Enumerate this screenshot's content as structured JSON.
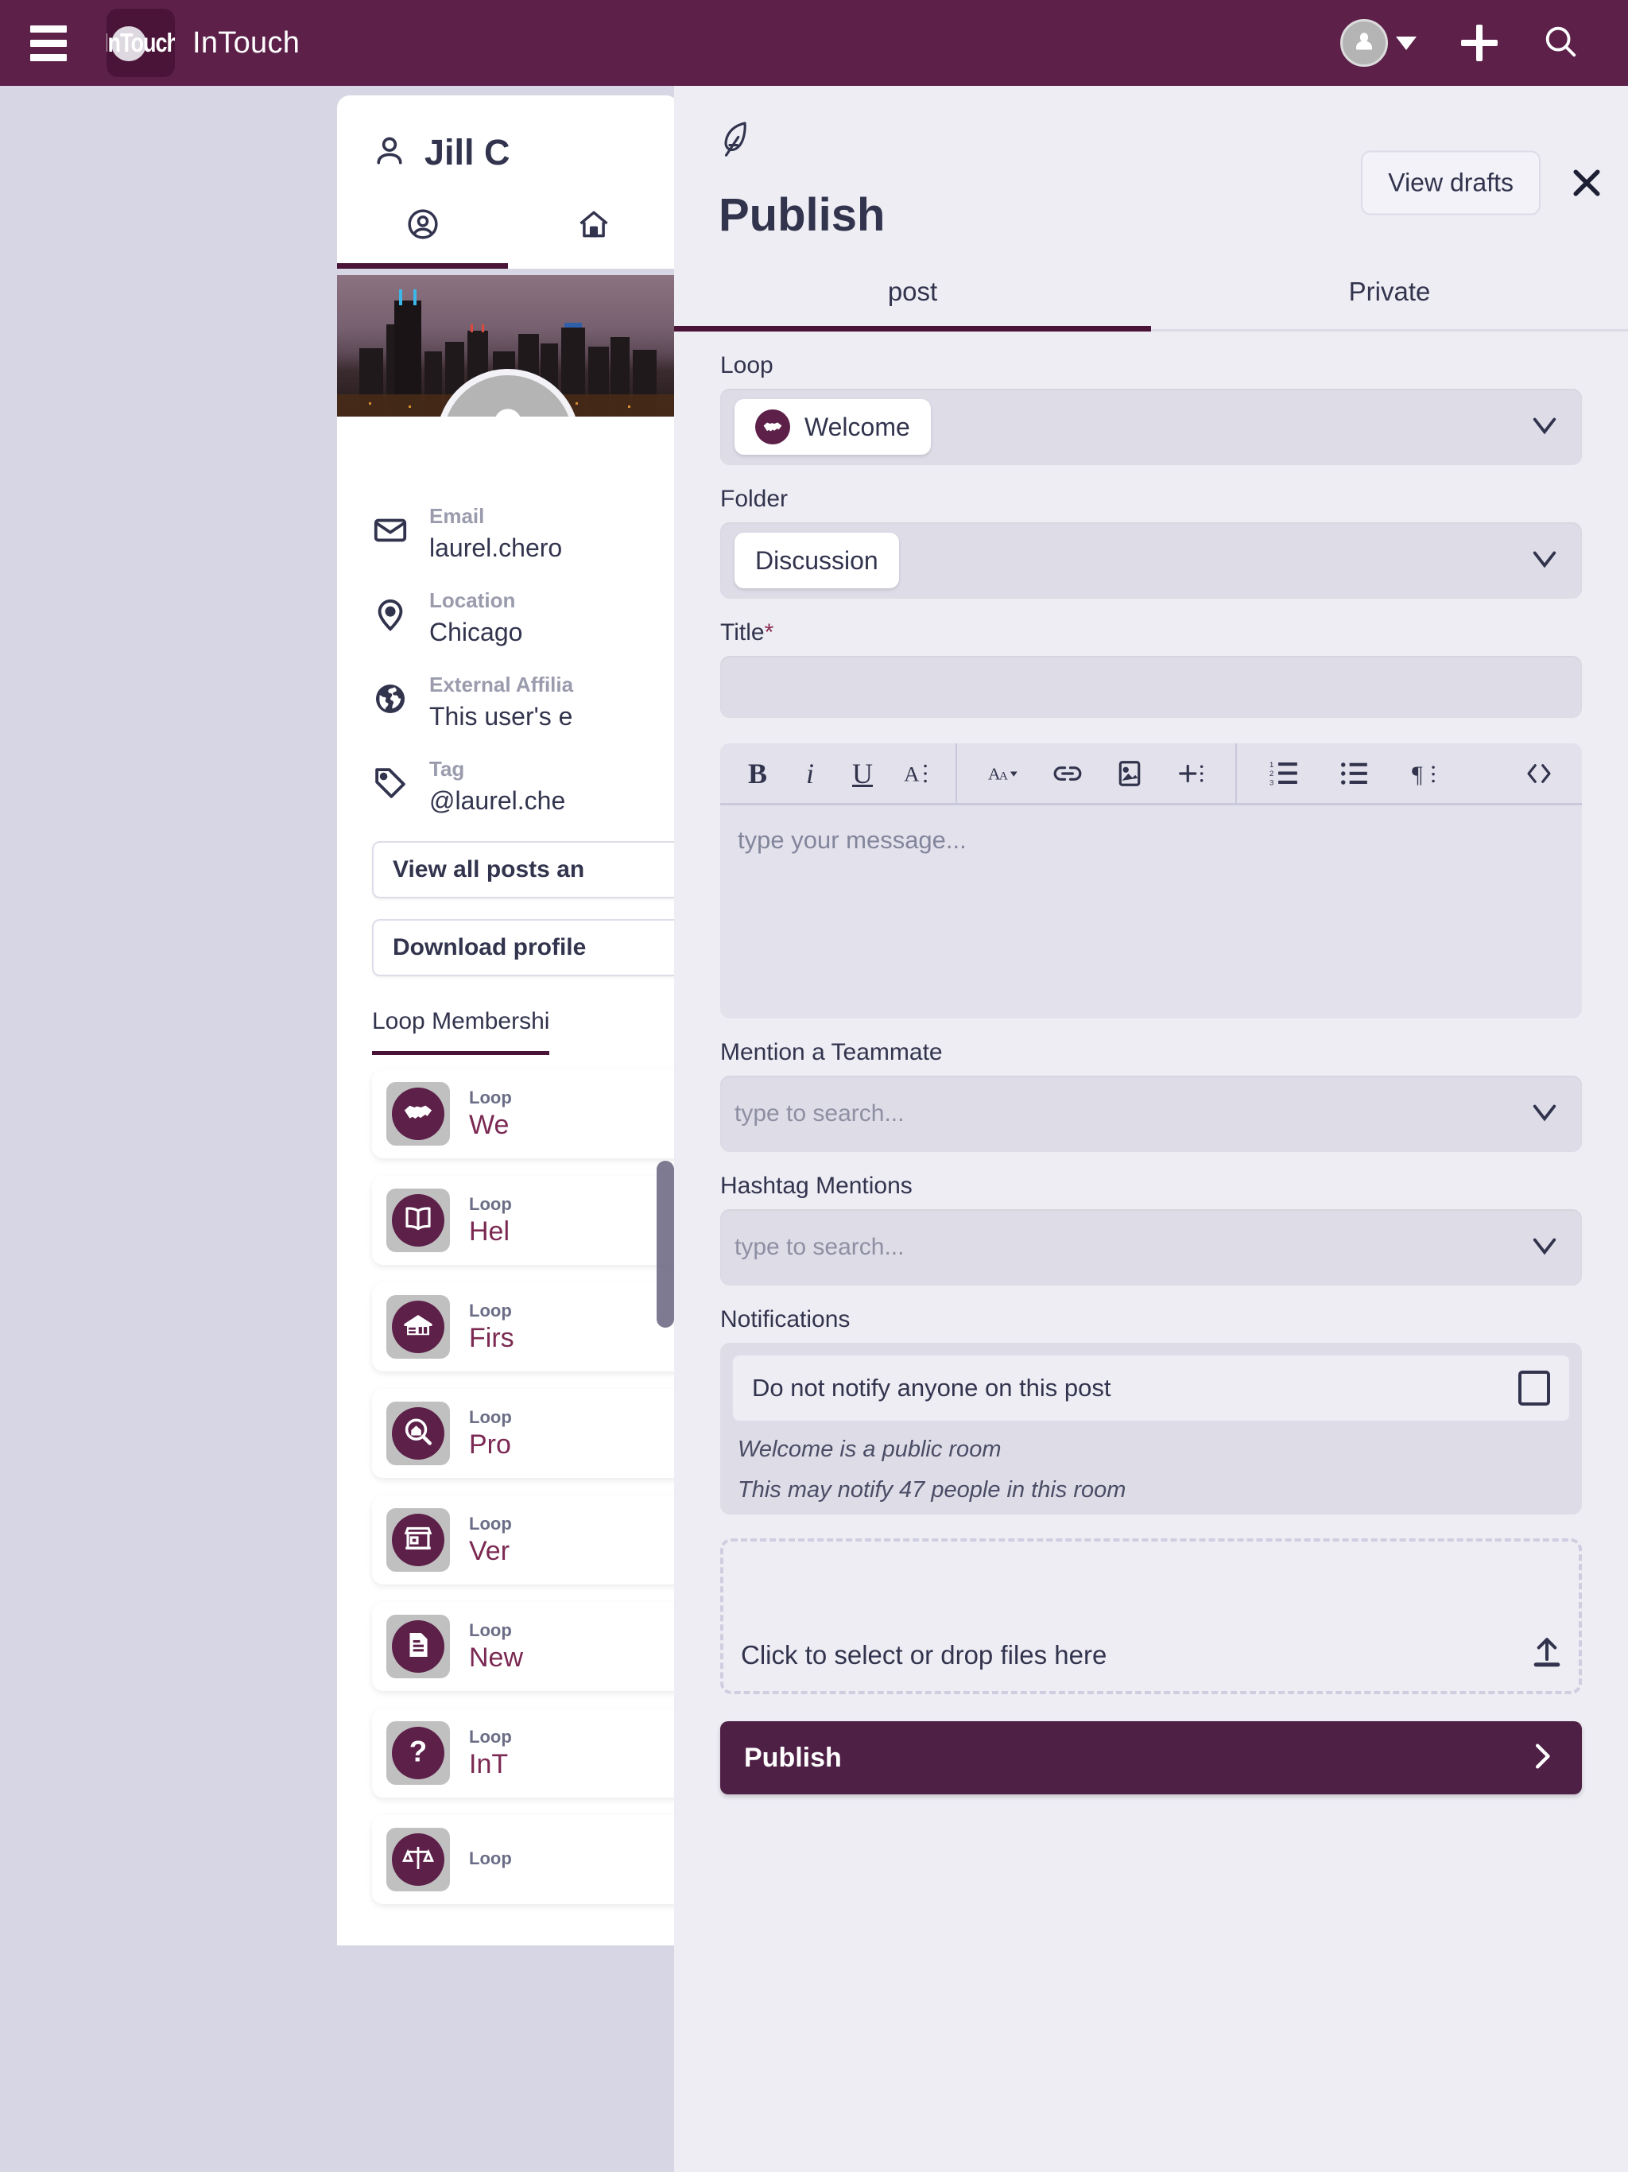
{
  "appbar": {
    "menu_icon": "hamburger-menu-icon",
    "logo_text": "InTouch",
    "brand": "InTouch",
    "avatar_icon": "user-avatar-icon",
    "caret_icon": "chevron-down-icon",
    "plus_icon": "plus-icon",
    "search_icon": "search-icon"
  },
  "profile": {
    "name": "Jill C",
    "name_icon": "person-icon",
    "tabs": [
      {
        "icon": "profile-circle-icon",
        "active": true
      },
      {
        "icon": "home-icon",
        "active": false
      }
    ],
    "avatar_icon": "user-avatar-icon",
    "fields": [
      {
        "icon": "envelope-icon",
        "label": "Email",
        "value": "laurel.chero"
      },
      {
        "icon": "location-pin-icon",
        "label": "Location",
        "value": "Chicago"
      },
      {
        "icon": "globe-icon",
        "label": "External Affilia",
        "value": "This user's e"
      },
      {
        "icon": "tag-icon",
        "label": "Tag",
        "value": "@laurel.che"
      }
    ],
    "buttons": [
      {
        "label": "View all posts an"
      },
      {
        "label": "Download profile"
      }
    ],
    "membership_tab": "Loop Membershi",
    "loops": [
      {
        "kicker": "Loop",
        "title": "We",
        "icon": "handshake-icon"
      },
      {
        "kicker": "Loop",
        "title": "Hel",
        "icon": "open-book-icon"
      },
      {
        "kicker": "Loop",
        "title": "Firs",
        "icon": "house-icon"
      },
      {
        "kicker": "Loop",
        "title": "Pro",
        "icon": "house-search-icon"
      },
      {
        "kicker": "Loop",
        "title": "Ver",
        "icon": "storefront-icon"
      },
      {
        "kicker": "Loop",
        "title": "New",
        "icon": "document-icon"
      },
      {
        "kicker": "Loop",
        "title": "InT",
        "icon": "question-mark-icon"
      },
      {
        "kicker": "Loop",
        "title": "",
        "icon": "scales-icon"
      }
    ]
  },
  "publish": {
    "feather_icon": "feather-pen-icon",
    "view_drafts_label": "View drafts",
    "close_icon": "close-icon",
    "title": "Publish",
    "tabs": [
      {
        "label": "post",
        "active": true
      },
      {
        "label": "Private",
        "active": false
      }
    ],
    "loop": {
      "label": "Loop",
      "selected": "Welcome",
      "chip_icon": "handshake-icon",
      "chevron_icon": "chevron-down-icon"
    },
    "folder": {
      "label": "Folder",
      "selected": "Discussion",
      "chevron_icon": "chevron-down-icon"
    },
    "title_field": {
      "label": "Title",
      "required_mark": "*",
      "value": "",
      "placeholder": ""
    },
    "toolbar": [
      {
        "name": "bold-icon",
        "glyph": "B"
      },
      {
        "name": "italic-icon",
        "glyph": "i"
      },
      {
        "name": "underline-icon",
        "glyph": "U"
      },
      {
        "name": "text-color-icon",
        "glyph": "A"
      },
      {
        "name": "font-size-icon",
        "glyph": "AA"
      },
      {
        "name": "link-icon",
        "glyph": "link"
      },
      {
        "name": "image-icon",
        "glyph": "image"
      },
      {
        "name": "insert-icon",
        "glyph": "plus"
      },
      {
        "name": "ordered-list-icon",
        "glyph": "ol"
      },
      {
        "name": "bullet-list-icon",
        "glyph": "ul"
      },
      {
        "name": "paragraph-icon",
        "glyph": "para"
      },
      {
        "name": "code-icon",
        "glyph": "code"
      },
      {
        "name": "emoji-icon",
        "glyph": "emoji"
      },
      {
        "name": "more-options-icon",
        "glyph": "dots"
      }
    ],
    "message": {
      "value": "",
      "placeholder": "type your message..."
    },
    "mention": {
      "label": "Mention a Teammate",
      "value": "",
      "placeholder": "type to search...",
      "chevron_icon": "chevron-down-icon"
    },
    "hashtag": {
      "label": "Hashtag Mentions",
      "value": "",
      "placeholder": "type to search...",
      "chevron_icon": "chevron-down-icon"
    },
    "notifications": {
      "label": "Notifications",
      "checkbox_label": "Do not notify anyone on this post",
      "checked": false,
      "note_line_1": "Welcome is a public room",
      "note_line_2": "This may notify 47 people in this room"
    },
    "dropzone": {
      "label": "Click to select or drop files here",
      "icon": "upload-icon"
    },
    "publish_button": {
      "label": "Publish",
      "chevron_icon": "chevron-right-icon"
    }
  },
  "colors": {
    "brand_purple": "#5c2049",
    "brand_purple_dark": "#4a1438",
    "panel_bg": "#eeedf4",
    "page_bg": "#d7d6e4",
    "ink": "#32344e",
    "muted": "#8e8fa3",
    "loop_title": "#7b2952"
  }
}
